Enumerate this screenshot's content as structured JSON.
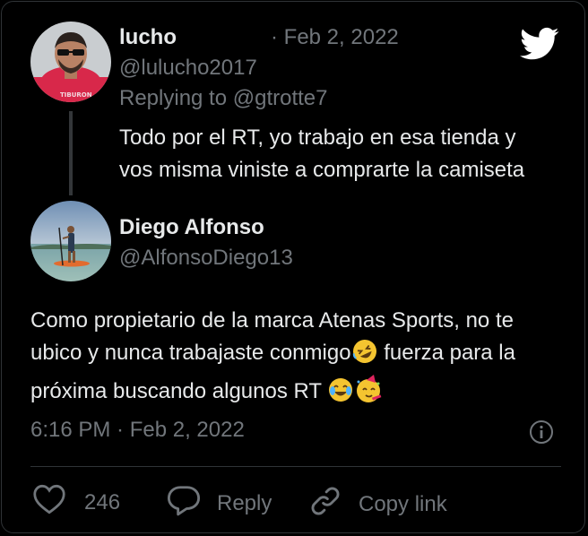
{
  "reply_tweet": {
    "author_name": "lucho",
    "date": "· Feb 2, 2022",
    "handle": "@lulucho2017",
    "replying_prefix": "Replying to ",
    "replying_to": "@gtrotte7",
    "text_line1": "Todo por el RT, yo trabajo en esa tienda y",
    "text_line2": "vos misma viniste a comprarte la camiseta"
  },
  "main_tweet": {
    "author_name": "Diego Alfonso",
    "handle": "@AlfonsoDiego13",
    "text_line1": "Como propietario de la marca Atenas Sports, no te",
    "text_line2a": "ubico y nunca trabajaste conmigo",
    "text_line2b": " fuerza para la",
    "text_line3": "próxima buscando algunos RT ",
    "timestamp": "6:16 PM · Feb 2, 2022"
  },
  "actions": {
    "like_count": "246",
    "reply_label": "Reply",
    "copy_link_label": "Copy link"
  },
  "colors": {
    "background": "#000000",
    "text": "#e7e9ea",
    "muted": "#71767b",
    "twitter_blue": "#1d9bf0",
    "emoji_yellow": "#f4c430"
  },
  "icons": [
    "twitter-bird-icon",
    "heart-icon",
    "reply-bubble-icon",
    "link-icon",
    "info-icon",
    "rofl-emoji-icon",
    "joy-emoji-icon",
    "party-face-emoji-icon"
  ]
}
